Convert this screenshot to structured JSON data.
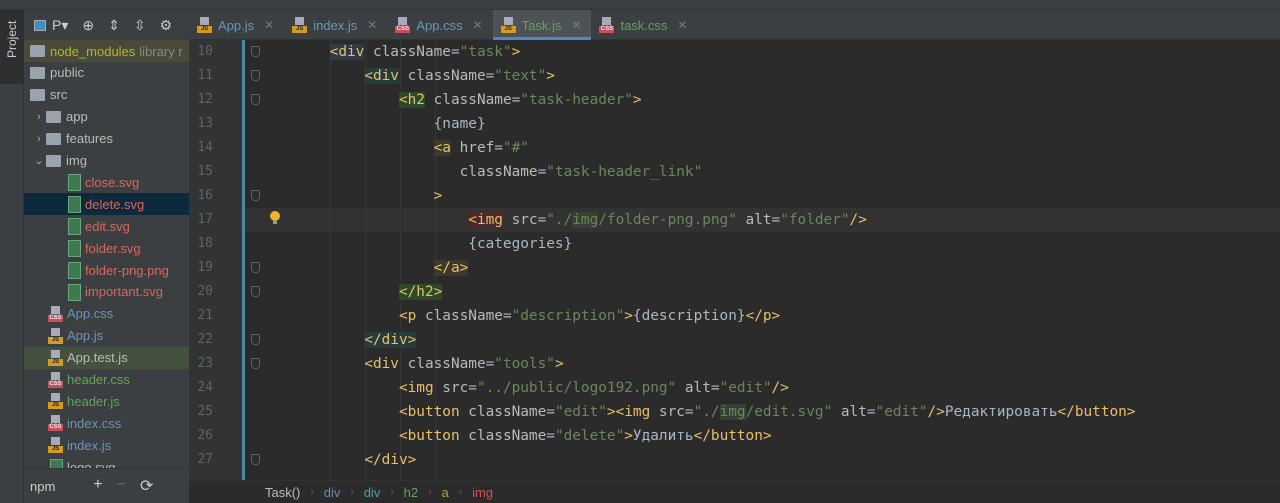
{
  "sidebar": {
    "tool_window_label": "Project",
    "view_label": "P",
    "items": [
      {
        "label": "node_modules",
        "suffix": "library r",
        "type": "folder",
        "depth": 0,
        "color": "#b5b52d",
        "selected": "lib"
      },
      {
        "label": "public",
        "type": "folder",
        "depth": 0,
        "color": "#bbbbbb"
      },
      {
        "label": "src",
        "type": "folder",
        "depth": 0,
        "color": "#bbbbbb",
        "open": true
      },
      {
        "label": "app",
        "type": "folder",
        "depth": 1,
        "color": "#bbbbbb",
        "arrow": "›"
      },
      {
        "label": "features",
        "type": "folder",
        "depth": 1,
        "color": "#bbbbbb",
        "arrow": "›"
      },
      {
        "label": "img",
        "type": "folder",
        "depth": 1,
        "color": "#bbbbbb",
        "arrow": "⌄"
      },
      {
        "label": "close.svg",
        "type": "svg",
        "depth": 2,
        "color": "#d4695e"
      },
      {
        "label": "delete.svg",
        "type": "svg",
        "depth": 2,
        "color": "#d4695e",
        "selected": "sel"
      },
      {
        "label": "edit.svg",
        "type": "svg",
        "depth": 2,
        "color": "#d4695e"
      },
      {
        "label": "folder.svg",
        "type": "svg",
        "depth": 2,
        "color": "#d4695e"
      },
      {
        "label": "folder-png.png",
        "type": "svg",
        "depth": 2,
        "color": "#d4695e"
      },
      {
        "label": "important.svg",
        "type": "svg",
        "depth": 2,
        "color": "#d4695e"
      },
      {
        "label": "App.css",
        "type": "css",
        "depth": 1,
        "color": "#6897bb"
      },
      {
        "label": "App.js",
        "type": "js",
        "depth": 1,
        "color": "#6897bb"
      },
      {
        "label": "App.test.js",
        "type": "js",
        "depth": 1,
        "color": "#bbbbbb",
        "selected": "test"
      },
      {
        "label": "header.css",
        "type": "css",
        "depth": 1,
        "color": "#62a35a"
      },
      {
        "label": "header.js",
        "type": "js",
        "depth": 1,
        "color": "#62a35a"
      },
      {
        "label": "index.css",
        "type": "css",
        "depth": 1,
        "color": "#6897bb"
      },
      {
        "label": "index.js",
        "type": "js",
        "depth": 1,
        "color": "#6897bb"
      },
      {
        "label": "logo.svg",
        "type": "svg",
        "depth": 1,
        "color": "#bbbbbb"
      }
    ],
    "npm_label": "npm"
  },
  "tabs": [
    {
      "label": "App.js",
      "type": "js",
      "color": "#6897bb"
    },
    {
      "label": "index.js",
      "type": "js",
      "color": "#6897bb"
    },
    {
      "label": "App.css",
      "type": "css",
      "color": "#6897bb"
    },
    {
      "label": "Task.js",
      "type": "js",
      "color": "#62a35a",
      "active": true
    },
    {
      "label": "task.css",
      "type": "css",
      "color": "#62a35a"
    }
  ],
  "editor": {
    "first_line": 10,
    "current_line": 17,
    "lines": [
      [
        [
          " ",
          "    "
        ],
        [
          "tag",
          "<div",
          "d0"
        ],
        [
          "attr",
          " className"
        ],
        [
          "txt",
          "="
        ],
        [
          "str",
          "\"task\""
        ],
        [
          "tag",
          ">"
        ]
      ],
      [
        [
          " ",
          "        "
        ],
        [
          "tag",
          "<div",
          "div"
        ],
        [
          "attr",
          " className"
        ],
        [
          "txt",
          "="
        ],
        [
          "str",
          "\"text\""
        ],
        [
          "tag",
          ">"
        ]
      ],
      [
        [
          " ",
          "            "
        ],
        [
          "tag",
          "<h2",
          "h2"
        ],
        [
          "attr",
          " className"
        ],
        [
          "txt",
          "="
        ],
        [
          "str",
          "\"task-header\""
        ],
        [
          "tag",
          ">"
        ]
      ],
      [
        [
          " ",
          "                "
        ],
        [
          "txt",
          "{name}"
        ]
      ],
      [
        [
          " ",
          "                "
        ],
        [
          "tag",
          "<a",
          "a"
        ],
        [
          "attr",
          " href"
        ],
        [
          "txt",
          "="
        ],
        [
          "str",
          "\"#\""
        ]
      ],
      [
        [
          " ",
          "                   "
        ],
        [
          "attr",
          "className"
        ],
        [
          "txt",
          "="
        ],
        [
          "str",
          "\"task-header_link\""
        ]
      ],
      [
        [
          " ",
          "                "
        ],
        [
          "tag",
          ">"
        ]
      ],
      [
        [
          " ",
          "                    "
        ],
        [
          "tag",
          "<img",
          "img"
        ],
        [
          "attr",
          " src"
        ],
        [
          "txt",
          "="
        ],
        [
          "str",
          "\"./"
        ],
        [
          "str",
          "img",
          "img2"
        ],
        [
          "str",
          "/folder-png.png\""
        ],
        [
          "attr",
          " alt"
        ],
        [
          "txt",
          "="
        ],
        [
          "str",
          "\"folder\""
        ],
        [
          "tag",
          "/>"
        ]
      ],
      [
        [
          " ",
          "                    "
        ],
        [
          "txt",
          "{categories}"
        ]
      ],
      [
        [
          " ",
          "                "
        ],
        [
          "tag",
          "</a>",
          "a"
        ]
      ],
      [
        [
          " ",
          "            "
        ],
        [
          "tag",
          "</h2>",
          "h2"
        ]
      ],
      [
        [
          " ",
          "            "
        ],
        [
          "tag",
          "<p"
        ],
        [
          "attr",
          " className"
        ],
        [
          "txt",
          "="
        ],
        [
          "str",
          "\"description\""
        ],
        [
          "tag",
          ">"
        ],
        [
          "txt",
          "{description}"
        ],
        [
          "tag",
          "</p>"
        ]
      ],
      [
        [
          " ",
          "        "
        ],
        [
          "tag",
          "</div>",
          "div"
        ]
      ],
      [
        [
          " ",
          "        "
        ],
        [
          "tag",
          "<div"
        ],
        [
          "attr",
          " className"
        ],
        [
          "txt",
          "="
        ],
        [
          "str",
          "\"tools\""
        ],
        [
          "tag",
          ">"
        ]
      ],
      [
        [
          " ",
          "            "
        ],
        [
          "tag",
          "<img"
        ],
        [
          "attr",
          " src"
        ],
        [
          "txt",
          "="
        ],
        [
          "str",
          "\"../public/logo192.png\""
        ],
        [
          "attr",
          " alt"
        ],
        [
          "txt",
          "="
        ],
        [
          "str",
          "\"edit\""
        ],
        [
          "tag",
          "/>"
        ]
      ],
      [
        [
          " ",
          "            "
        ],
        [
          "tag",
          "<button"
        ],
        [
          "attr",
          " className"
        ],
        [
          "txt",
          "="
        ],
        [
          "str",
          "\"edit\""
        ],
        [
          "tag",
          ">"
        ],
        [
          "tag",
          "<img"
        ],
        [
          "attr",
          " src"
        ],
        [
          "txt",
          "="
        ],
        [
          "str",
          "\"./"
        ],
        [
          "str",
          "img",
          "img2"
        ],
        [
          "str",
          "/edit.svg\""
        ],
        [
          "attr",
          " alt"
        ],
        [
          "txt",
          "="
        ],
        [
          "str",
          "\"edit\""
        ],
        [
          "tag",
          "/>"
        ],
        [
          "txt",
          "Редактировать"
        ],
        [
          "tag",
          "</button>"
        ]
      ],
      [
        [
          " ",
          "            "
        ],
        [
          "tag",
          "<button"
        ],
        [
          "attr",
          " className"
        ],
        [
          "txt",
          "="
        ],
        [
          "str",
          "\"delete\""
        ],
        [
          "tag",
          ">"
        ],
        [
          "txt",
          "Удалить"
        ],
        [
          "tag",
          "</button>"
        ]
      ],
      [
        [
          " ",
          "        "
        ],
        [
          "tag",
          "</div>"
        ]
      ]
    ]
  },
  "breadcrumbs": [
    {
      "label": "Task()",
      "color": "#bbbbbb"
    },
    {
      "label": "div",
      "color": "#6a8caf"
    },
    {
      "label": "div",
      "color": "#4f9fa0"
    },
    {
      "label": "h2",
      "color": "#62a35a"
    },
    {
      "label": "a",
      "color": "#b5a23a"
    },
    {
      "label": "img",
      "color": "#c75450"
    }
  ]
}
